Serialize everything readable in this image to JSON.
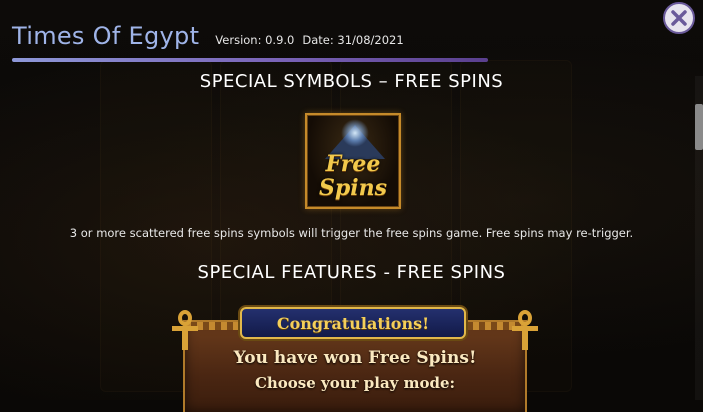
{
  "header": {
    "title": "Times Of Egypt",
    "version": "Version: 0.9.0",
    "date": "Date: 31/08/2021"
  },
  "close_button": {
    "icon": "close-icon"
  },
  "sections": {
    "symbols_title": "SPECIAL SYMBOLS – FREE SPINS",
    "symbol_text_line1": "Free",
    "symbol_text_line2": "Spins",
    "description": "3 or more scattered free spins symbols will trigger the free spins game. Free spins may re-trigger.",
    "features_title": "SPECIAL FEATURES - FREE SPINS"
  },
  "feature_preview": {
    "banner": "Congratulations!",
    "line1": "You have won Free Spins!",
    "line2": "Choose your play mode:"
  },
  "colors": {
    "title": "#9fb4e8",
    "rule_start": "#8e98d8",
    "rule_end": "#5a3f8e",
    "gold": "#f2c94c"
  }
}
